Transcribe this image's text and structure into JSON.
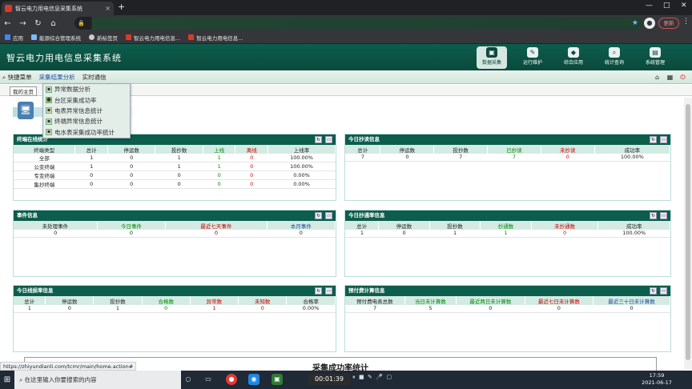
{
  "browser": {
    "tab_title": "智云电力用电信息采集系统",
    "tab_close": "×",
    "new_tab": "+",
    "update_label": "更新",
    "address": "",
    "bookmarks": [
      {
        "label": "应用",
        "color": "#4285f4"
      },
      {
        "label": "能源综合管理系统",
        "color": "#7fb6ff"
      },
      {
        "label": "新标签页",
        "color": "#cccccc"
      },
      {
        "label": "智云电力用电信息...",
        "color": "#d93a2b"
      },
      {
        "label": "智云电力用电信息...",
        "color": "#d93a2b"
      }
    ]
  },
  "app": {
    "title": "智云电力用电信息采集系统",
    "modules": [
      {
        "label": "数据采集",
        "active": true
      },
      {
        "label": "运行维护",
        "active": false
      },
      {
        "label": "综合应用",
        "active": false
      },
      {
        "label": "统计查询",
        "active": false
      },
      {
        "label": "系统管理",
        "active": false
      }
    ],
    "menu": [
      {
        "label": "快捷菜单"
      },
      {
        "label": "采集结果分析"
      },
      {
        "label": "实时通信"
      }
    ],
    "breadcrumb": "我的主页",
    "dropdown": [
      "异常数据分析",
      "台区采集成功率",
      "电表异常信息统计",
      "终端异常信息统计",
      "电水表采集成功率统计"
    ]
  },
  "panels": {
    "terminal": {
      "title": "终端在线统计",
      "headers": [
        "终端类型",
        "总计",
        "停运数",
        "投抄数",
        "上线",
        "离线",
        "上线率"
      ],
      "rows": [
        [
          "全部",
          "1",
          "0",
          "1",
          "1",
          "0",
          "100.00%"
        ],
        [
          "公变终端",
          "1",
          "0",
          "1",
          "1",
          "0",
          "100.00%"
        ],
        [
          "专变终端",
          "0",
          "0",
          "0",
          "0",
          "0",
          "0.00%"
        ],
        [
          "集抄终端",
          "0",
          "0",
          "0",
          "0",
          "0",
          "0.00%"
        ]
      ]
    },
    "reading": {
      "title": "今日抄读信息",
      "headers": [
        "总计",
        "停运数",
        "投抄数",
        "已抄读",
        "未抄读",
        "成功率"
      ],
      "rows": [
        [
          "7",
          "0",
          "7",
          "7",
          "0",
          "100.00%"
        ]
      ]
    },
    "events": {
      "title": "事件信息",
      "headers": [
        "未处理事件",
        "今日事件",
        "最近七天事件",
        "本月事件"
      ],
      "rows": [
        [
          "0",
          "0",
          "0",
          "0"
        ]
      ]
    },
    "comm": {
      "title": "今日抄通率信息",
      "headers": [
        "总计",
        "停运数",
        "投抄数",
        "抄通数",
        "未抄通数",
        "成功率"
      ],
      "rows": [
        [
          "1",
          "0",
          "1",
          "1",
          "0",
          "100.00%"
        ]
      ]
    },
    "lineloss": {
      "title": "今日线损率信息",
      "headers": [
        "总计",
        "停运数",
        "投抄数",
        "合格数",
        "异常数",
        "未知数",
        "合格率"
      ],
      "rows": [
        [
          "1",
          "0",
          "1",
          "0",
          "1",
          "0",
          "0.00%"
        ]
      ]
    },
    "prepaid": {
      "title": "预付费计算信息",
      "headers": [
        "预付费电表总数",
        "当日未计算数",
        "最近两日未计算数",
        "最近七日未计算数",
        "最近三十日未计算数"
      ],
      "rows": [
        [
          "7",
          "5",
          "0",
          "0",
          "0"
        ]
      ]
    }
  },
  "overlay_title": "采集成功率统计",
  "status_url": "https://zhiyundianli.com/tcmr/main/home.action#",
  "taskbar": {
    "search_placeholder": "在这里输入你要搜索的内容",
    "timer": "00:01:39",
    "time": "17:59",
    "date": "2021-06-17"
  }
}
